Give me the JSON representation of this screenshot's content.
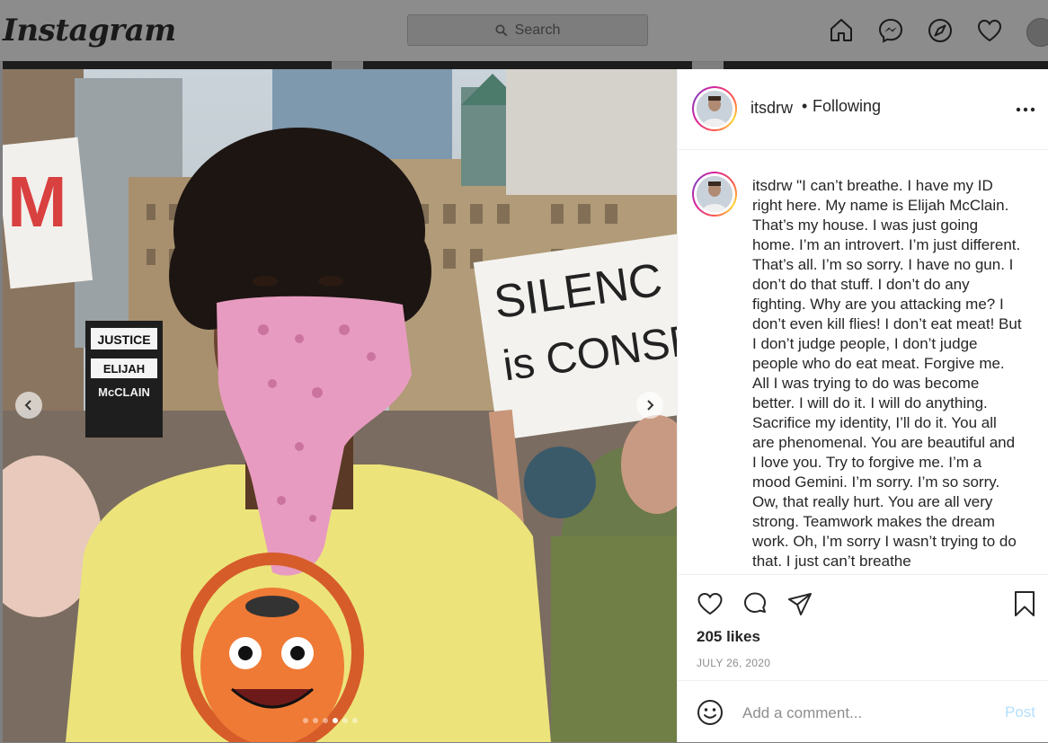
{
  "header": {
    "logo": "Instagram",
    "search_placeholder": "Search"
  },
  "nav_icons": [
    "home-icon",
    "messenger-icon",
    "explore-icon",
    "heart-icon",
    "profile-avatar"
  ],
  "post": {
    "username": "itsdrw",
    "separator": "•",
    "follow_status": "Following",
    "caption_user": "itsdrw",
    "caption": "\"I can’t breathe. I have my ID right here. My name is Elijah McClain. That’s my house. I was just going home. I’m an introvert. I’m just different. That’s all. I’m so sorry. I have no gun. I don’t do that stuff. I don’t do any fighting. Why are you attacking me? I don’t even kill flies! I don’t eat meat! But I don’t judge people, I don’t judge people who do eat meat. Forgive me. All I was trying to do was become better. I will do it. I will do anything. Sacrifice my identity, I’ll do it. You all are phenomenal. You are beautiful and I love you. Try to forgive me. I’m a mood Gemini. I’m sorry. I’m so sorry. Ow, that really hurt. You are all very strong. Teamwork makes the dream work. Oh, I’m sorry I wasn’t trying to do that. I just can’t breathe",
    "likes": "205 likes",
    "date": "JULY 26, 2020",
    "comment_placeholder": "Add a comment...",
    "post_label": "Post",
    "carousel": {
      "total": 6,
      "active": 3
    },
    "photo_signs": {
      "sign1_line1": "SILENC",
      "sign1_line2": "is CONSEN",
      "sign2_line1": "JUSTICE",
      "sign2_line2": "ELIJAH",
      "sign2_line3": "McCLAIN"
    }
  },
  "colors": {
    "overlay": "#7f7f7f",
    "text": "#262626",
    "muted": "#8e8e8e",
    "post_disabled": "#b2dffc",
    "bandana": "#e89bc0",
    "shirt": "#ece47a"
  }
}
